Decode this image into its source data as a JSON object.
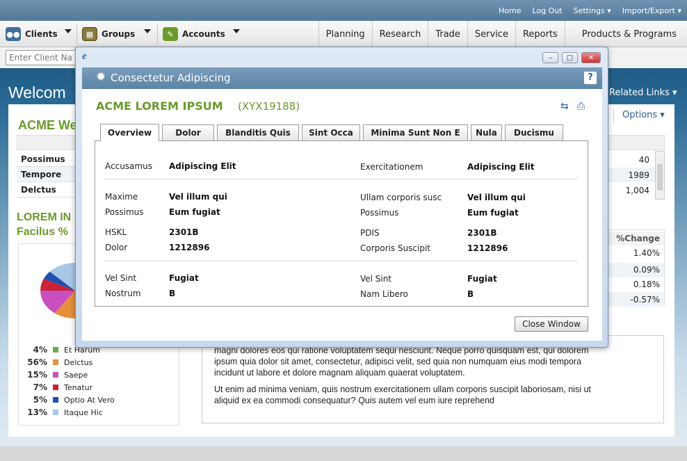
{
  "top_links": [
    "Home",
    "Log Out",
    "Settings ▾",
    "Import/Export ▾"
  ],
  "toolbar": {
    "clients": "Clients",
    "groups": "Groups",
    "accounts": "Accounts",
    "nav": [
      "Planning",
      "Research",
      "Trade",
      "Service",
      "Reports",
      "Products & Programs"
    ]
  },
  "search": {
    "placeholder": "Enter Client Na"
  },
  "page": {
    "welcome": "Welcom",
    "related_links": "Related Links ▾",
    "options": "Options ▾",
    "section_heading": "ACME We",
    "table_rows": [
      {
        "label": "Possimus",
        "value": "40"
      },
      {
        "label": "Tempore",
        "value": "1989"
      },
      {
        "label": "Delctus",
        "value": "1,004"
      }
    ],
    "chart_heading_1": "LOREM IN",
    "chart_heading_2": "Facilus %",
    "change_header": "%Change",
    "change_values": [
      "1.40%",
      "0.09%",
      "0.18%",
      "-0.57%"
    ],
    "paragraph_1_line_0": "magni dolores eos qui ratione voluptatem sequi nesciunt. Neque porro quisquam est, qui dolorem",
    "paragraph_1_line_1": "ipsum quia dolor sit amet, consectetur, adipisci velit, sed quia non numquam eius modi tempora",
    "paragraph_1_line_2": "incidunt ut labore et dolore magnam aliquam quaerat voluptatem.",
    "paragraph_2_line_0": "Ut enim ad minima veniam, quis nostrum exercitationem ullam corporis suscipit laboriosam, nisi ut",
    "paragraph_2_line_1": "aliquid ex ea commodi consequatur? Quis autem vel eum iure reprehend"
  },
  "chart_data": {
    "type": "pie",
    "title": "",
    "categories": [
      "Et Harum",
      "Delctus",
      "Saepe",
      "Tenatur",
      "Optio At Vero",
      "Itaque Hic"
    ],
    "values": [
      4,
      56,
      15,
      7,
      5,
      13
    ],
    "labels": [
      "4%",
      "56%",
      "15%",
      "7%",
      "5%",
      "13%"
    ],
    "colors": [
      "#6aa84f",
      "#e69138",
      "#c94fc0",
      "#cc2233",
      "#1f4fb0",
      "#a8c8e8"
    ]
  },
  "modal": {
    "title": "Consectetur Adipiscing",
    "company": "ACME LOREM IPSUM",
    "code": "(XYX19188)",
    "tabs": [
      "Overview",
      "Dolor",
      "Blanditis Quis",
      "Sint Occa",
      "Minima Sunt Non E",
      "Nula",
      "Ducismu"
    ],
    "fields": {
      "accusamus_label": "Accusamus",
      "accusamus_value": "Adipiscing Elit",
      "exercitationem_label": "Exercitationem",
      "exercitationem_value": "Adipiscing Elit",
      "maxime_label": "Maxime",
      "maxime_value": "Vel illum qui",
      "ullam_label": "Ullam corporis susc",
      "ullam_value": "Vel illum qui",
      "possimus_label": "Possimus",
      "possimus_value": "Eum fugiat",
      "possimus2_label": "Possimus",
      "possimus2_value": "Eum fugiat",
      "hskl_label": "HSKL",
      "hskl_value": "2301B",
      "pdis_label": "PDIS",
      "pdis_value": "2301B",
      "dolor_label": "Dolor",
      "dolor_value": "1212896",
      "corporis_label": "Corporis Suscipit",
      "corporis_value": "1212896",
      "velsint_label": "Vel Sint",
      "velsint_value": "Fugiat",
      "velsint2_label": "Vel Sint",
      "velsint2_value": "Fugiat",
      "nostrum_label": "Nostrum",
      "nostrum_value": "B",
      "namlibero_label": "Nam Libero",
      "namlibero_value": "B"
    },
    "close_button": "Close Window",
    "help": "?"
  }
}
